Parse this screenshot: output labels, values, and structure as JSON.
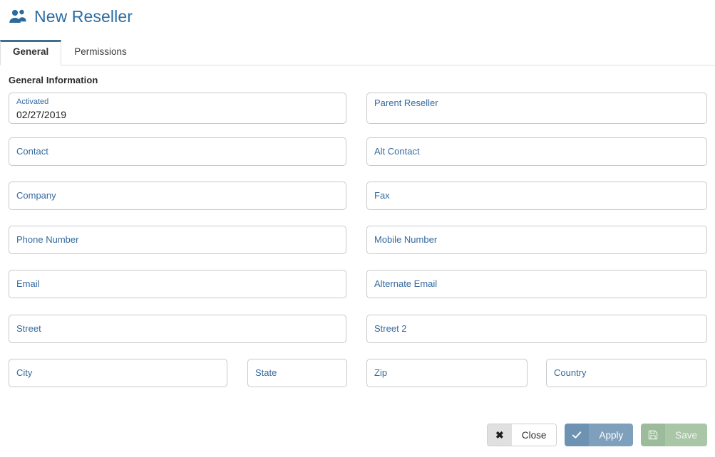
{
  "header": {
    "icon": "users-icon",
    "title": "New Reseller",
    "title_color": "#2d6ca2"
  },
  "tabs": [
    {
      "label": "General",
      "active": true
    },
    {
      "label": "Permissions",
      "active": false
    }
  ],
  "section": {
    "title": "General Information"
  },
  "fields": {
    "activated": {
      "label": "Activated",
      "value": "02/27/2019"
    },
    "parent_reseller": {
      "placeholder": "Parent Reseller",
      "value": ""
    },
    "contact": {
      "placeholder": "Contact",
      "value": ""
    },
    "alt_contact": {
      "placeholder": "Alt Contact",
      "value": ""
    },
    "company": {
      "placeholder": "Company",
      "value": ""
    },
    "fax": {
      "placeholder": "Fax",
      "value": ""
    },
    "phone_number": {
      "placeholder": "Phone Number",
      "value": ""
    },
    "mobile_number": {
      "placeholder": "Mobile Number",
      "value": ""
    },
    "email": {
      "placeholder": "Email",
      "value": ""
    },
    "alternate_email": {
      "placeholder": "Alternate Email",
      "value": ""
    },
    "street": {
      "placeholder": "Street",
      "value": ""
    },
    "street2": {
      "placeholder": "Street 2",
      "value": ""
    },
    "city": {
      "placeholder": "City",
      "value": ""
    },
    "state": {
      "placeholder": "State",
      "value": ""
    },
    "zip": {
      "placeholder": "Zip",
      "value": ""
    },
    "country": {
      "placeholder": "Country",
      "value": ""
    }
  },
  "buttons": {
    "close": {
      "label": "Close",
      "icon": "close-x-icon",
      "color": "#ffffff"
    },
    "apply": {
      "label": "Apply",
      "icon": "check-icon",
      "color": "#7fa0bd"
    },
    "save": {
      "label": "Save",
      "icon": "floppy-disk-icon",
      "color": "#a9c6a6"
    }
  }
}
